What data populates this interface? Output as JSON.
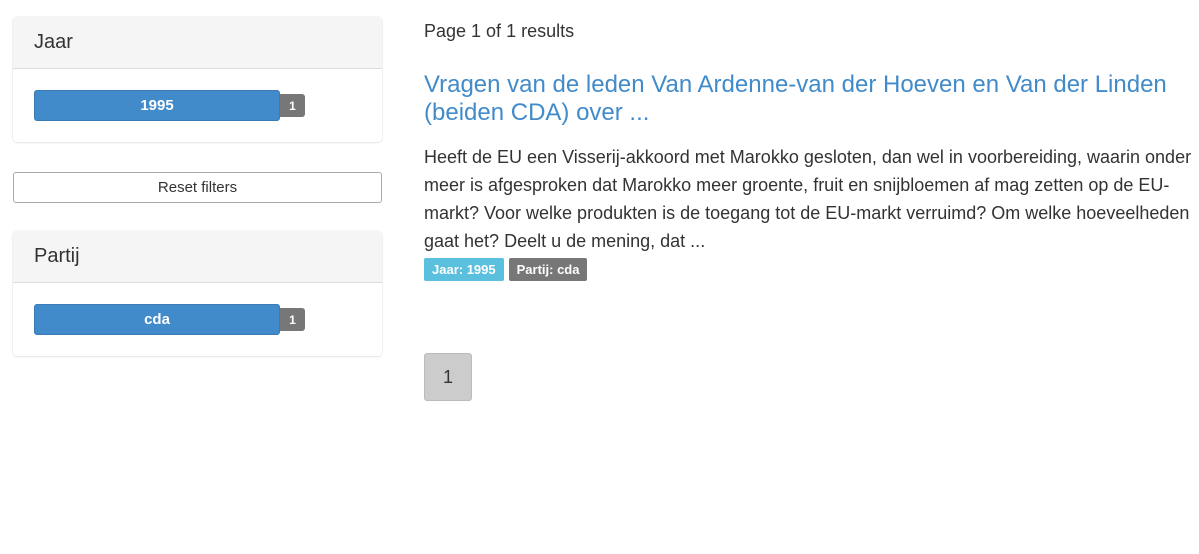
{
  "sidebar": {
    "year_facet": {
      "heading": "Jaar",
      "items": [
        {
          "label": "1995",
          "count": "1"
        }
      ]
    },
    "reset_label": "Reset filters",
    "party_facet": {
      "heading": "Partij",
      "items": [
        {
          "label": "cda",
          "count": "1"
        }
      ]
    }
  },
  "results": {
    "count_text": "Page 1 of 1 results",
    "items": [
      {
        "title": "Vragen van de leden Van Ardenne-van der Hoeven en Van der Linden (beiden CDA) over ...",
        "snippet": "Heeft de EU een Visserij-akkoord met Marokko gesloten, dan wel in voorbereiding, waarin onder meer is afgesproken dat Marokko meer groente, fruit en snijbloemen af mag zetten op de EU-markt? Voor welke produkten is de toegang tot de EU-markt verruimd? Om welke hoeveelheden gaat het? Deelt u de mening, dat ...",
        "tags": [
          "Jaar: 1995",
          "Partij: cda"
        ]
      }
    ]
  },
  "pagination": {
    "pages": [
      "1"
    ],
    "current": "1"
  },
  "colors": {
    "primary": "#428bca",
    "tag_info": "#5bc0de",
    "tag_default": "#777777",
    "badge": "#777777"
  }
}
